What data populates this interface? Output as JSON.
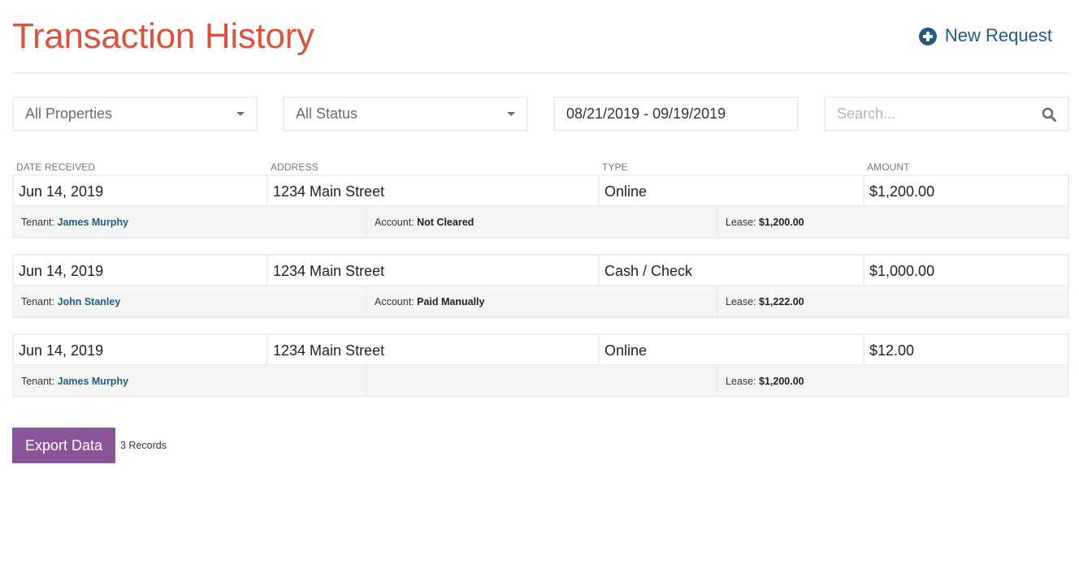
{
  "header": {
    "title": "Transaction History",
    "new_request_label": "New Request",
    "title_color": "#d9543f",
    "accent_color": "#235a80"
  },
  "filters": {
    "properties": {
      "selected": "All Properties"
    },
    "status": {
      "selected": "All Status"
    },
    "date_range": {
      "value": "08/21/2019 - 09/19/2019"
    },
    "search": {
      "value": "",
      "placeholder": "Search..."
    }
  },
  "table": {
    "columns": [
      "DATE RECEIVED",
      "ADDRESS",
      "TYPE",
      "AMOUNT"
    ],
    "records": [
      {
        "date": "Jun 14, 2019",
        "address": "1234 Main Street",
        "type": "Online",
        "amount": "$1,200.00",
        "tenant_label": "Tenant:",
        "tenant": "James Murphy",
        "account_label": "Account:",
        "account": "Not Cleared",
        "lease_label": "Lease:",
        "lease": "$1,200.00"
      },
      {
        "date": "Jun 14, 2019",
        "address": "1234 Main Street",
        "type": "Cash / Check",
        "amount": "$1,000.00",
        "tenant_label": "Tenant:",
        "tenant": "John Stanley",
        "account_label": "Account:",
        "account": "Paid Manually",
        "lease_label": "Lease:",
        "lease": "$1,222.00"
      },
      {
        "date": "Jun 14, 2019",
        "address": "1234 Main Street",
        "type": "Online",
        "amount": "$12.00",
        "tenant_label": "Tenant:",
        "tenant": "James Murphy",
        "account_label": null,
        "account": null,
        "lease_label": "Lease:",
        "lease": "$1,200.00"
      }
    ]
  },
  "footer": {
    "export_label": "Export Data",
    "record_count": "3 Records",
    "export_color": "#8a5499"
  }
}
